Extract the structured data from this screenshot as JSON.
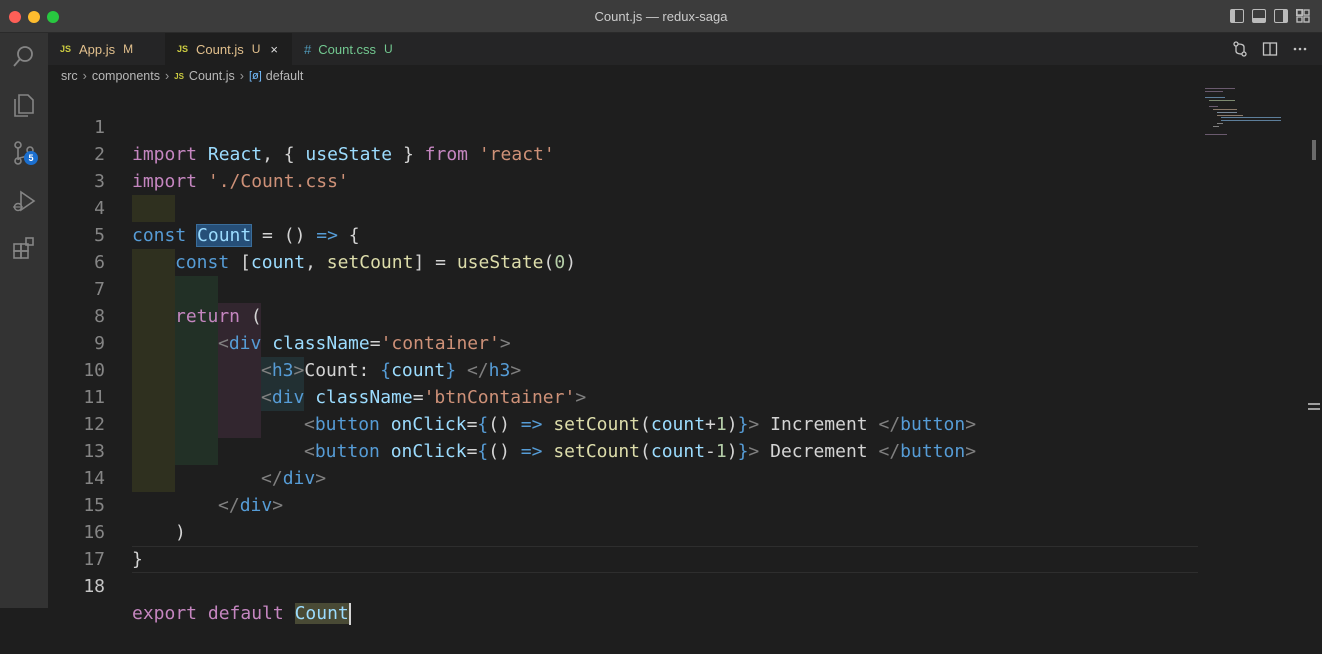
{
  "window": {
    "title": "Count.js — redux-saga"
  },
  "activity_bar": {
    "icons": [
      "search-icon",
      "explorer-icon",
      "source-control-icon",
      "run-debug-icon",
      "extensions-icon"
    ],
    "source_control_badge": "5"
  },
  "tabs": [
    {
      "icon": "JS",
      "label": "App.js",
      "state": "M"
    },
    {
      "icon": "JS",
      "label": "Count.js",
      "state": "U",
      "close": "×"
    },
    {
      "icon": "#",
      "label": "Count.css",
      "state": "U"
    }
  ],
  "breadcrumb": {
    "items": [
      "src",
      "components",
      "Count.js",
      "default"
    ],
    "file_icon": "JS"
  },
  "editor": {
    "line_numbers": [
      "1",
      "2",
      "3",
      "4",
      "5",
      "6",
      "7",
      "8",
      "9",
      "10",
      "11",
      "12",
      "13",
      "14",
      "15",
      "16",
      "17",
      "18"
    ],
    "current_line": "18",
    "code": {
      "l1": [
        "import",
        "React",
        ", { ",
        "useState",
        " } ",
        "from",
        "'react'"
      ],
      "l2": [
        "import",
        "'./Count.css'"
      ],
      "l4": [
        "const",
        "Count",
        " = () ",
        "=>",
        " {"
      ],
      "l5": [
        "const",
        " [",
        "count",
        ", ",
        "setCount",
        "] = ",
        "useState",
        "(",
        "0",
        ")"
      ],
      "l7": [
        "return",
        " ("
      ],
      "l8": [
        "<",
        "div",
        "className",
        "=",
        "'container'",
        ">"
      ],
      "l9": [
        "<",
        "h3",
        ">",
        "Count: ",
        "{",
        "count",
        "}",
        " </",
        "h3",
        ">"
      ],
      "l10": [
        "<",
        "div",
        "className",
        "=",
        "'btnContainer'",
        ">"
      ],
      "l11": [
        "<",
        "button",
        "onClick",
        "=",
        "{",
        "() ",
        "=>",
        "setCount",
        "(",
        "count",
        "+",
        "1",
        ")",
        "}",
        ">",
        " Increment ",
        "</",
        "button",
        ">"
      ],
      "l12": [
        "<",
        "button",
        "onClick",
        "=",
        "{",
        "() ",
        "=>",
        "setCount",
        "(",
        "count",
        "-",
        "1",
        ")",
        "}",
        ">",
        " Decrement ",
        "</",
        "button",
        ">"
      ],
      "l13": [
        "</",
        "div",
        ">"
      ],
      "l14": [
        "</",
        "div",
        ">"
      ],
      "l15": [
        ")"
      ],
      "l16": [
        "}"
      ],
      "l18": [
        "export",
        "default",
        "Count"
      ]
    }
  }
}
